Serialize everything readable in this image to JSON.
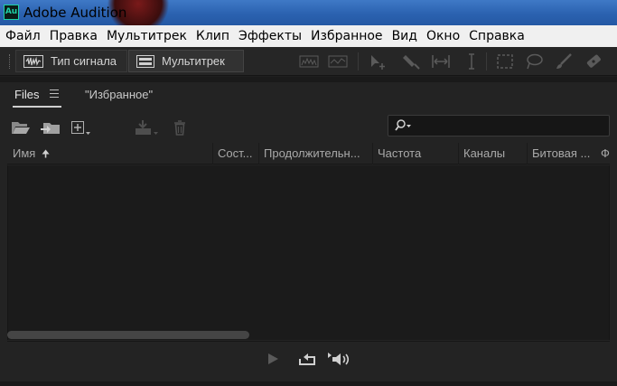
{
  "window": {
    "title": "Adobe Audition",
    "icon_text": "Au"
  },
  "menu": [
    "Файл",
    "Правка",
    "Мультитрек",
    "Клип",
    "Эффекты",
    "Избранное",
    "Вид",
    "Окно",
    "Справка"
  ],
  "toolbar": {
    "waveform_label": "Тип сигнала",
    "multitrack_label": "Мультитрек",
    "tools": [
      "spectral-display-icon",
      "pitch-display-icon",
      "move-tool-icon",
      "razor-tool-icon",
      "slip-tool-icon",
      "time-selection-icon",
      "marquee-select-icon",
      "lasso-select-icon",
      "paintbrush-icon",
      "spot-healing-icon"
    ]
  },
  "panel": {
    "tabs": [
      {
        "label": "Files",
        "active": true
      },
      {
        "label": "\"Избранное\"",
        "active": false
      }
    ],
    "toolbar_icons": [
      "open-file-icon",
      "import-file-icon",
      "new-file-icon",
      "insert-into-multitrack-icon",
      "delete-icon"
    ],
    "search": {
      "value": "",
      "placeholder": ""
    },
    "columns": [
      "Имя",
      "Сост...",
      "Продолжительн...",
      "Частота",
      "Каналы",
      "Битовая ...",
      "Ф"
    ],
    "sort": {
      "column": "Имя",
      "direction": "ascending"
    },
    "rows": [],
    "bottom_controls": [
      "play-icon",
      "loop-icon",
      "autoplay-volume-icon"
    ]
  },
  "colors": {
    "accent": "#1ed1a6",
    "panel": "#232323",
    "list_bg": "#1b1b1b",
    "title_bar": "#2b62b0"
  }
}
